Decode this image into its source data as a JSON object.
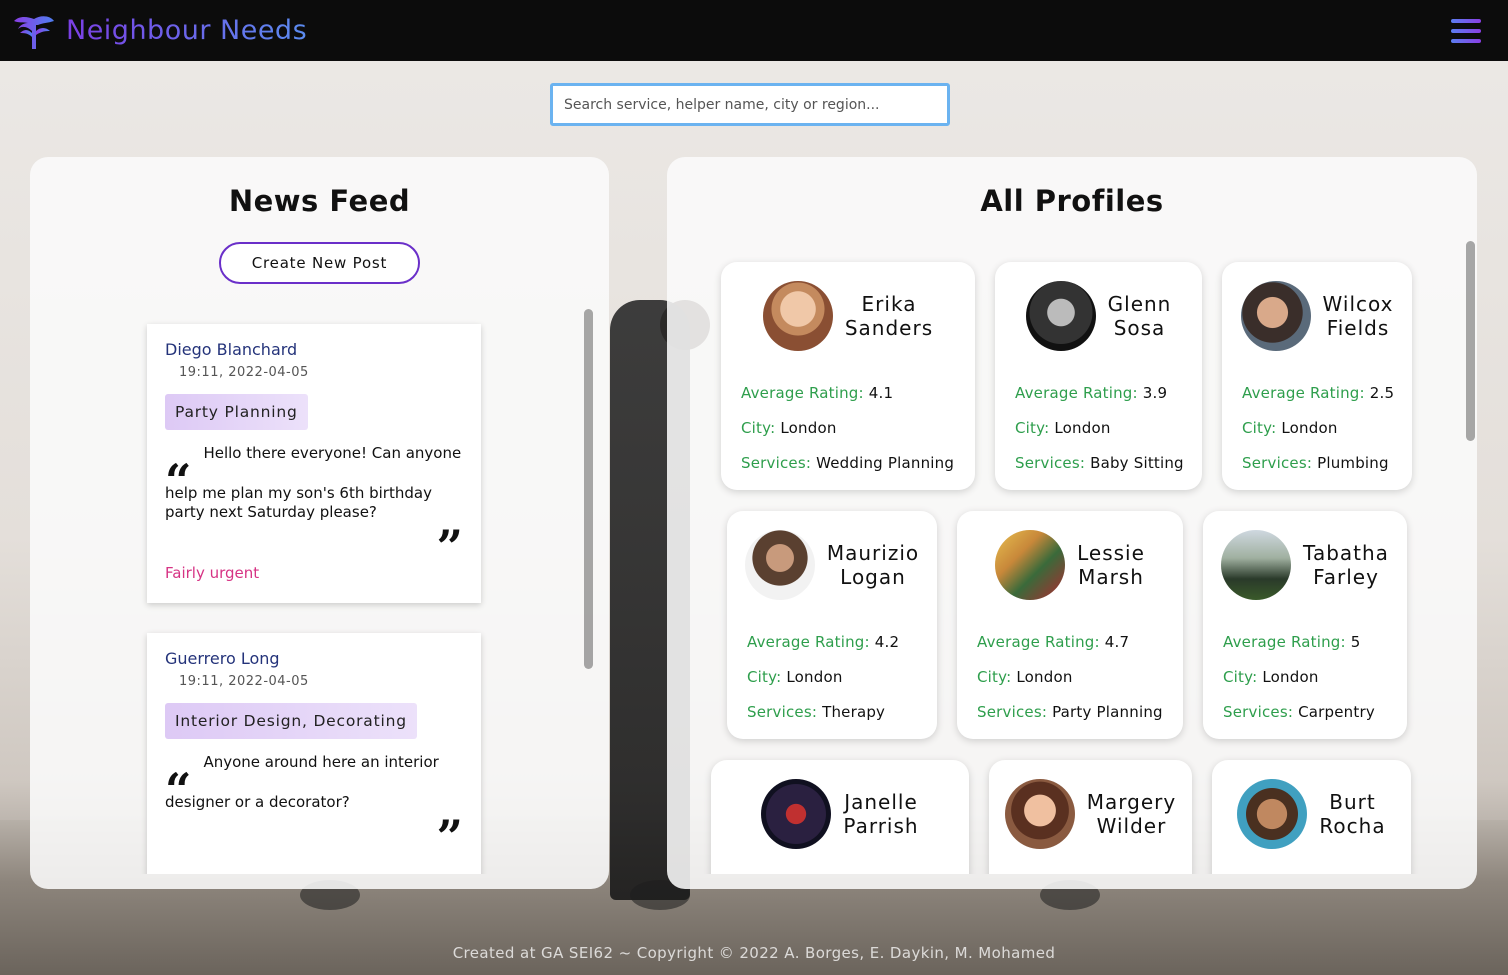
{
  "header": {
    "brand": "Neighbour Needs",
    "brand_colors": [
      "#7b3fe4",
      "#5b8cf0"
    ],
    "logo_icon": "tree-icon",
    "menu_icon": "hamburger-menu-icon"
  },
  "search": {
    "placeholder": "Search service, helper name, city or region..."
  },
  "news_feed": {
    "title": "News Feed",
    "create_button": "Create New Post",
    "posts": [
      {
        "author": "Diego Blanchard",
        "time": "19:11, 2022-04-05",
        "tag": "Party Planning",
        "body": "Hello there everyone! Can anyone help me plan my son's 6th birthday party next Saturday please?",
        "urgency": "Fairly urgent"
      },
      {
        "author": "Guerrero Long",
        "time": "19:11, 2022-04-05",
        "tag": "Interior Design, Decorating",
        "body": "Anyone around here an interior designer or a decorator?",
        "urgency": ""
      }
    ]
  },
  "profiles": {
    "title": "All Profiles",
    "labels": {
      "rating": "Average Rating:",
      "city": "City:",
      "services": "Services:"
    },
    "items": [
      {
        "first": "Erika",
        "last": "Sanders",
        "rating": "4.1",
        "city": "London",
        "services": "Wedding Planning"
      },
      {
        "first": "Glenn",
        "last": "Sosa",
        "rating": "3.9",
        "city": "London",
        "services": "Baby Sitting"
      },
      {
        "first": "Wilcox",
        "last": "Fields",
        "rating": "2.5",
        "city": "London",
        "services": "Plumbing"
      },
      {
        "first": "Maurizio",
        "last": "Logan",
        "rating": "4.2",
        "city": "London",
        "services": "Therapy"
      },
      {
        "first": "Lessie",
        "last": "Marsh",
        "rating": "4.7",
        "city": "London",
        "services": "Party Planning"
      },
      {
        "first": "Tabatha",
        "last": "Farley",
        "rating": "5",
        "city": "London",
        "services": "Carpentry"
      },
      {
        "first": "Janelle",
        "last": "Parrish"
      },
      {
        "first": "Margery",
        "last": "Wilder"
      },
      {
        "first": "Burt",
        "last": "Rocha"
      }
    ]
  },
  "footer": {
    "text": "Created at GA SEI62 ~ Copyright © 2022 A. Borges, E. Daykin, M. Mohamed"
  },
  "colors": {
    "accent_purple": "#6a2fc9",
    "label_green": "#2e9e4c",
    "urgency_pink": "#d63384",
    "author_blue": "#24337a",
    "search_border": "#6bb3f0"
  }
}
